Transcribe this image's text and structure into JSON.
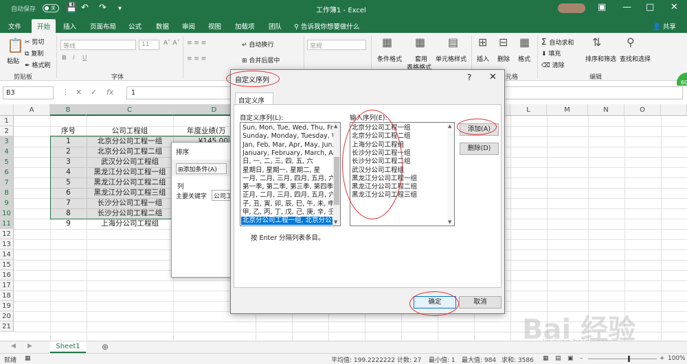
{
  "titlebar": {
    "autosave_label": "自动保存",
    "autosave_state": "关",
    "title": "工作簿1  -  Excel"
  },
  "tabs": [
    "文件",
    "开始",
    "插入",
    "页面布局",
    "公式",
    "数据",
    "审阅",
    "视图",
    "加载项",
    "团队"
  ],
  "tell_me": "告诉我你想要做什么",
  "share": "共享",
  "ribbon": {
    "clipboard": {
      "paste": "粘贴",
      "cut": "剪切",
      "copy": "复制",
      "format_painter": "格式刷",
      "group": "剪贴板"
    },
    "font": {
      "name": "等线",
      "size": "11",
      "group": "字体"
    },
    "alignment": {
      "wrap": "自动换行",
      "merge": "合并后居中"
    },
    "number": {
      "format": "常规"
    },
    "styles": {
      "conditional": "条件格式",
      "table_format_line1": "套用",
      "table_format_line2": "表格格式",
      "cell_styles": "单元格样式"
    },
    "cells": {
      "insert": "插入",
      "delete": "删除",
      "format": "格式",
      "group_partial": "元格"
    },
    "editing": {
      "autosum": "自动求和",
      "fill": "填充",
      "clear": "清除",
      "sort_filter": "排序和筛选",
      "find_select": "查找和选择",
      "group": "编辑"
    },
    "badge": "60"
  },
  "formula": {
    "namebox": "B3",
    "value": "1"
  },
  "columns": [
    "A",
    "B",
    "C",
    "D",
    "E",
    "F",
    "G",
    "H",
    "I",
    "J",
    "K",
    "L",
    "M",
    "N",
    "O"
  ],
  "rows": [
    "1",
    "2",
    "3",
    "4",
    "5",
    "6",
    "7",
    "8",
    "9",
    "10",
    "11",
    "12",
    "13",
    "14",
    "15",
    "16",
    "17",
    "18",
    "19",
    "20",
    "21"
  ],
  "sheet": {
    "header_no": "序号",
    "header_group": "公司工程组",
    "header_perf": "年度业绩(万",
    "d3": "¥145.00",
    "data": [
      {
        "no": "1",
        "group": "北京分公司工程一组"
      },
      {
        "no": "2",
        "group": "北京分公司工程二组"
      },
      {
        "no": "3",
        "group": "武汉分公司工程组"
      },
      {
        "no": "4",
        "group": "黑龙江分公司工程一组"
      },
      {
        "no": "5",
        "group": "黑龙江分公司工程二组"
      },
      {
        "no": "6",
        "group": "黑龙江分公司工程三组"
      },
      {
        "no": "7",
        "group": "长沙分公司工程一组"
      },
      {
        "no": "8",
        "group": "长沙分公司工程二组"
      },
      {
        "no": "9",
        "group": "上海分公司工程组"
      }
    ]
  },
  "sort_dialog": {
    "title": "排序",
    "add_condition": "添加条件(A)",
    "column_label": "列",
    "primary_key": "主要关键字",
    "key_value": "公司工"
  },
  "dialog": {
    "title": "自定义序列",
    "tab": "自定义序列",
    "list_label": "自定义序列(L):",
    "entries_label": "输入序列(E):",
    "lists": [
      "Sun, Mon, Tue, Wed, Thu, Fri, S",
      "Sunday, Monday, Tuesday, Wed",
      "Jan, Feb, Mar, Apr, May, Jun, Ju",
      "January, February, March, April",
      "日, 一, 二, 三, 四, 五, 六",
      "星期日, 星期一, 星期二, 星",
      "一月, 二月, 三月, 四月, 五月, 六月,",
      "第一季, 第二季, 第三季, 第四季",
      "正月, 二月, 三月, 四月, 五月, 六月,",
      "子, 丑, 寅, 卯, 辰, 巳, 午, 未, 申, 酉",
      "甲, 乙, 丙, 丁, 戊, 己, 庚, 辛, 壬, 癸",
      "北京分公司工程一组, 北京分公司工"
    ],
    "entries": [
      "北京分公司工程一组",
      "北京分公司工程二组",
      "上海分公司工程组",
      "长沙分公司工程一组",
      "长沙分公司工程二组",
      "武汉分公司工程组",
      "黑龙江分公司工程一组",
      "黑龙江分公司工程二组",
      "黑龙江分公司工程三组"
    ],
    "add_button": "添加(A)",
    "delete_button": "删除(D)",
    "hint": "按 Enter 分隔列表条目。",
    "ok_button": "确定",
    "cancel_button": "取消"
  },
  "sheet_tab": "Sheet1",
  "status": {
    "ready": "就绪",
    "average": "平均值: 199.2222222",
    "count": "计数: 27",
    "min": "最小值: 1",
    "max": "最大值: 984",
    "sum": "求和: 3586",
    "zoom": "100%"
  },
  "watermark": {
    "main": "Bai 经验",
    "sub": "jingyan.baidu.com"
  }
}
